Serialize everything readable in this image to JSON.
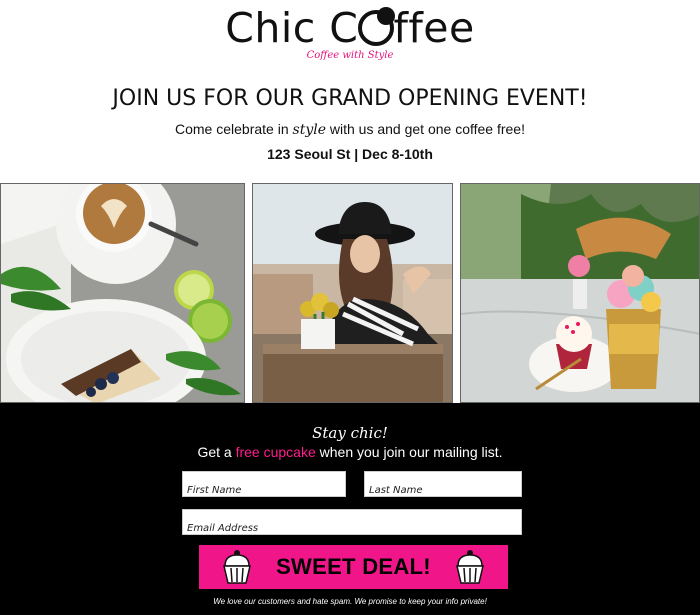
{
  "brand": {
    "name_part1": "Chic C",
    "name_part2": "ffee",
    "tagline": "Coffee with Style"
  },
  "hero": {
    "headline": "JOIN US FOR OUR GRAND OPENING EVENT!",
    "sub_before": "Come celebrate in ",
    "sub_style": "style",
    "sub_after": " with us and get one coffee free!",
    "event_info": "123 Seoul St | Dec 8-10th"
  },
  "photos": [
    {
      "name": "latte-and-cake-photo"
    },
    {
      "name": "woman-in-hat-photo"
    },
    {
      "name": "cupcake-and-dessert-photo"
    }
  ],
  "signup": {
    "stay_chic": "Stay chic!",
    "offer_before": "Get a ",
    "offer_highlight": "free cupcake",
    "offer_after": " when you join our mailing list.",
    "first_name_placeholder": "First Name",
    "last_name_placeholder": "Last Name",
    "email_placeholder": "Email Address",
    "button_label": "SWEET DEAL!",
    "spam_note": "We love our customers and hate spam. We promise to keep your info private!"
  },
  "colors": {
    "accent_pink": "#f0168a",
    "background_dark": "#000000"
  }
}
